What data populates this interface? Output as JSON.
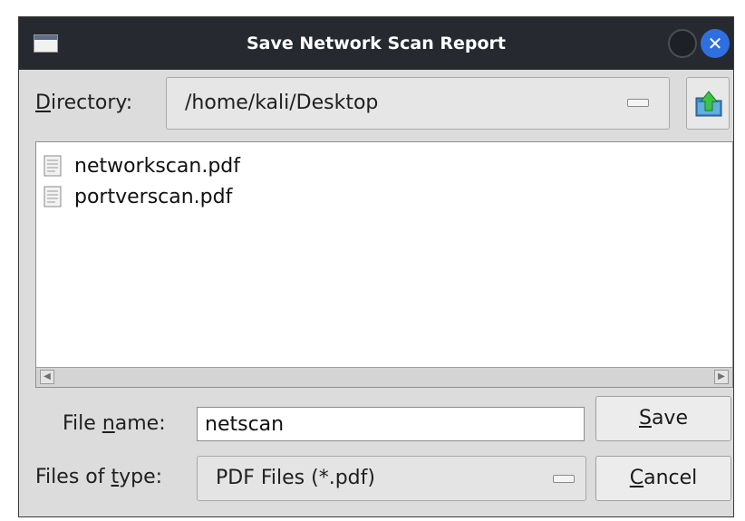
{
  "window": {
    "title": "Save Network Scan Report"
  },
  "directory": {
    "label_first": "D",
    "label_rest": "irectory:",
    "value": "/home/kali/Desktop"
  },
  "files": [
    {
      "name": "networkscan.pdf",
      "icon": "document-icon"
    },
    {
      "name": "portverscan.pdf",
      "icon": "document-icon"
    }
  ],
  "filename": {
    "label_pre": "File ",
    "label_u": "n",
    "label_post": "ame:",
    "value": "netscan"
  },
  "filetype": {
    "label_pre": "Files of ",
    "label_u": "t",
    "label_post": "ype:",
    "value": "PDF Files (*.pdf)"
  },
  "buttons": {
    "save_u": "S",
    "save_rest": "ave",
    "cancel_u": "C",
    "cancel_rest": "ancel"
  },
  "colors": {
    "titlebar": "#262a30",
    "close_button": "#2f6fe0",
    "dialog_bg": "#dcdcdc"
  }
}
